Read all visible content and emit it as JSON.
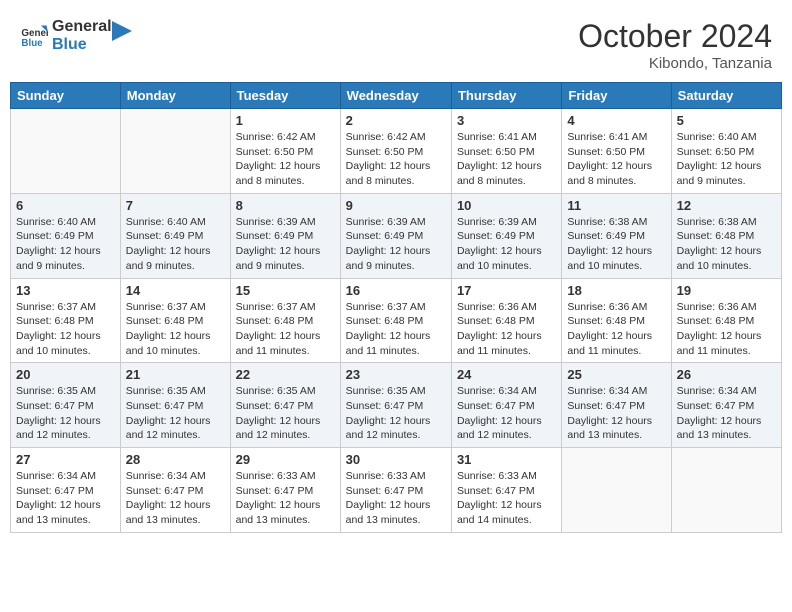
{
  "header": {
    "logo_line1": "General",
    "logo_line2": "Blue",
    "month_year": "October 2024",
    "location": "Kibondo, Tanzania"
  },
  "weekdays": [
    "Sunday",
    "Monday",
    "Tuesday",
    "Wednesday",
    "Thursday",
    "Friday",
    "Saturday"
  ],
  "weeks": [
    [
      {
        "day": "",
        "info": ""
      },
      {
        "day": "",
        "info": ""
      },
      {
        "day": "1",
        "info": "Sunrise: 6:42 AM\nSunset: 6:50 PM\nDaylight: 12 hours and 8 minutes."
      },
      {
        "day": "2",
        "info": "Sunrise: 6:42 AM\nSunset: 6:50 PM\nDaylight: 12 hours and 8 minutes."
      },
      {
        "day": "3",
        "info": "Sunrise: 6:41 AM\nSunset: 6:50 PM\nDaylight: 12 hours and 8 minutes."
      },
      {
        "day": "4",
        "info": "Sunrise: 6:41 AM\nSunset: 6:50 PM\nDaylight: 12 hours and 8 minutes."
      },
      {
        "day": "5",
        "info": "Sunrise: 6:40 AM\nSunset: 6:50 PM\nDaylight: 12 hours and 9 minutes."
      }
    ],
    [
      {
        "day": "6",
        "info": "Sunrise: 6:40 AM\nSunset: 6:49 PM\nDaylight: 12 hours and 9 minutes."
      },
      {
        "day": "7",
        "info": "Sunrise: 6:40 AM\nSunset: 6:49 PM\nDaylight: 12 hours and 9 minutes."
      },
      {
        "day": "8",
        "info": "Sunrise: 6:39 AM\nSunset: 6:49 PM\nDaylight: 12 hours and 9 minutes."
      },
      {
        "day": "9",
        "info": "Sunrise: 6:39 AM\nSunset: 6:49 PM\nDaylight: 12 hours and 9 minutes."
      },
      {
        "day": "10",
        "info": "Sunrise: 6:39 AM\nSunset: 6:49 PM\nDaylight: 12 hours and 10 minutes."
      },
      {
        "day": "11",
        "info": "Sunrise: 6:38 AM\nSunset: 6:49 PM\nDaylight: 12 hours and 10 minutes."
      },
      {
        "day": "12",
        "info": "Sunrise: 6:38 AM\nSunset: 6:48 PM\nDaylight: 12 hours and 10 minutes."
      }
    ],
    [
      {
        "day": "13",
        "info": "Sunrise: 6:37 AM\nSunset: 6:48 PM\nDaylight: 12 hours and 10 minutes."
      },
      {
        "day": "14",
        "info": "Sunrise: 6:37 AM\nSunset: 6:48 PM\nDaylight: 12 hours and 10 minutes."
      },
      {
        "day": "15",
        "info": "Sunrise: 6:37 AM\nSunset: 6:48 PM\nDaylight: 12 hours and 11 minutes."
      },
      {
        "day": "16",
        "info": "Sunrise: 6:37 AM\nSunset: 6:48 PM\nDaylight: 12 hours and 11 minutes."
      },
      {
        "day": "17",
        "info": "Sunrise: 6:36 AM\nSunset: 6:48 PM\nDaylight: 12 hours and 11 minutes."
      },
      {
        "day": "18",
        "info": "Sunrise: 6:36 AM\nSunset: 6:48 PM\nDaylight: 12 hours and 11 minutes."
      },
      {
        "day": "19",
        "info": "Sunrise: 6:36 AM\nSunset: 6:48 PM\nDaylight: 12 hours and 11 minutes."
      }
    ],
    [
      {
        "day": "20",
        "info": "Sunrise: 6:35 AM\nSunset: 6:47 PM\nDaylight: 12 hours and 12 minutes."
      },
      {
        "day": "21",
        "info": "Sunrise: 6:35 AM\nSunset: 6:47 PM\nDaylight: 12 hours and 12 minutes."
      },
      {
        "day": "22",
        "info": "Sunrise: 6:35 AM\nSunset: 6:47 PM\nDaylight: 12 hours and 12 minutes."
      },
      {
        "day": "23",
        "info": "Sunrise: 6:35 AM\nSunset: 6:47 PM\nDaylight: 12 hours and 12 minutes."
      },
      {
        "day": "24",
        "info": "Sunrise: 6:34 AM\nSunset: 6:47 PM\nDaylight: 12 hours and 12 minutes."
      },
      {
        "day": "25",
        "info": "Sunrise: 6:34 AM\nSunset: 6:47 PM\nDaylight: 12 hours and 13 minutes."
      },
      {
        "day": "26",
        "info": "Sunrise: 6:34 AM\nSunset: 6:47 PM\nDaylight: 12 hours and 13 minutes."
      }
    ],
    [
      {
        "day": "27",
        "info": "Sunrise: 6:34 AM\nSunset: 6:47 PM\nDaylight: 12 hours and 13 minutes."
      },
      {
        "day": "28",
        "info": "Sunrise: 6:34 AM\nSunset: 6:47 PM\nDaylight: 12 hours and 13 minutes."
      },
      {
        "day": "29",
        "info": "Sunrise: 6:33 AM\nSunset: 6:47 PM\nDaylight: 12 hours and 13 minutes."
      },
      {
        "day": "30",
        "info": "Sunrise: 6:33 AM\nSunset: 6:47 PM\nDaylight: 12 hours and 13 minutes."
      },
      {
        "day": "31",
        "info": "Sunrise: 6:33 AM\nSunset: 6:47 PM\nDaylight: 12 hours and 14 minutes."
      },
      {
        "day": "",
        "info": ""
      },
      {
        "day": "",
        "info": ""
      }
    ]
  ]
}
